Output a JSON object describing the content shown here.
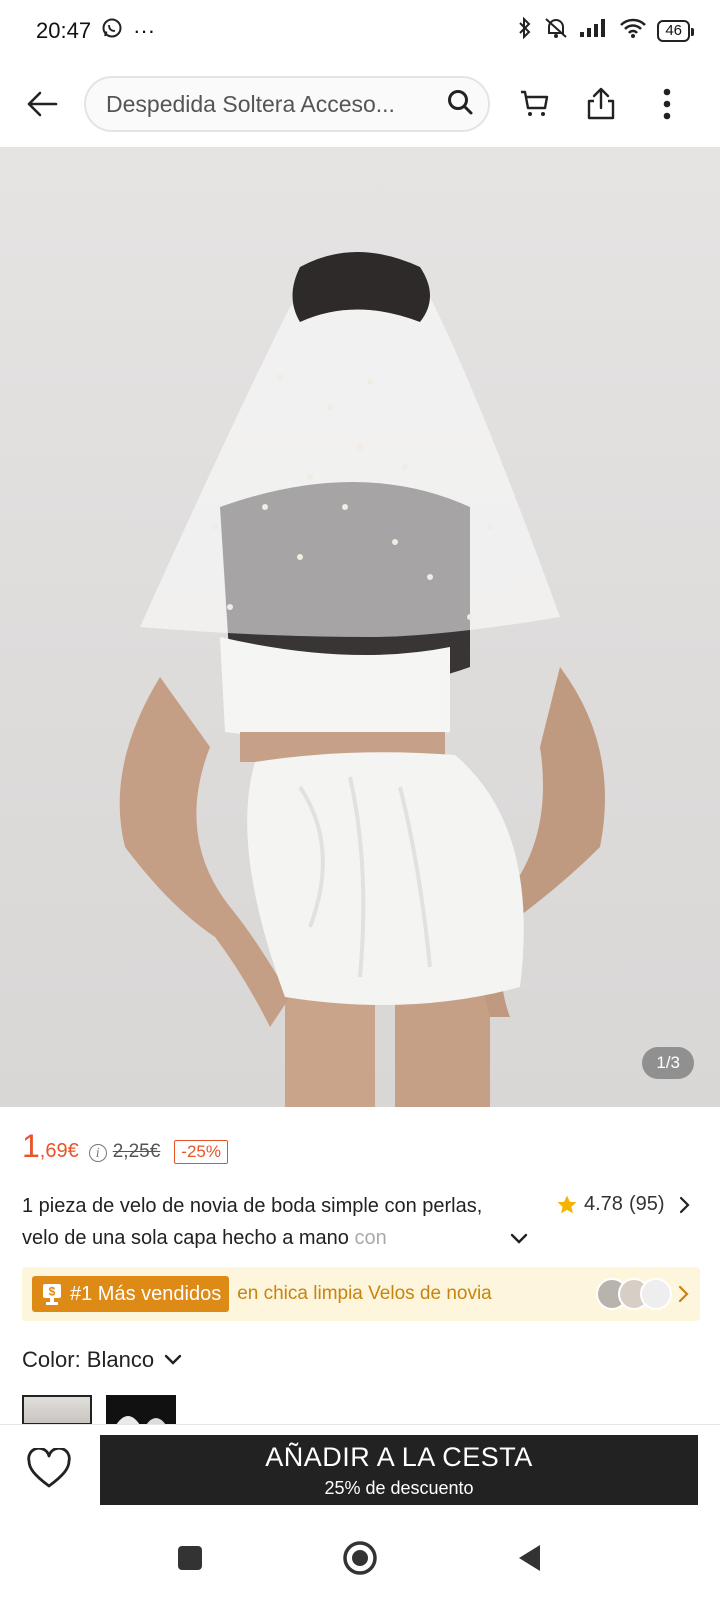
{
  "status_bar": {
    "time": "20:47",
    "more_dots": "···",
    "battery": "46"
  },
  "header": {
    "search_text": "Despedida Soltera Acceso..."
  },
  "gallery": {
    "counter": "1/3"
  },
  "price": {
    "current_int": "1",
    "current_dec": ",69€",
    "original": "2,25€",
    "discount": "-25%"
  },
  "product": {
    "title_main": "1 pieza de velo de novia de boda simple con perlas, velo de una sola capa hecho a mano",
    "title_fade": "con",
    "rating": "4.78",
    "reviews": "(95)"
  },
  "bestseller": {
    "badge_label": "#1 Más vendidos",
    "text": "en chica limpia Velos de novia"
  },
  "color": {
    "label": "Color: Blanco"
  },
  "cart": {
    "button_label": "AÑADIR A LA CESTA",
    "sub_label": "25% de descuento"
  },
  "colors": {
    "accent": "#e8542a",
    "badge": "#dd8a17",
    "banner_bg": "#fdf5dc",
    "cart_bg": "#222222"
  }
}
